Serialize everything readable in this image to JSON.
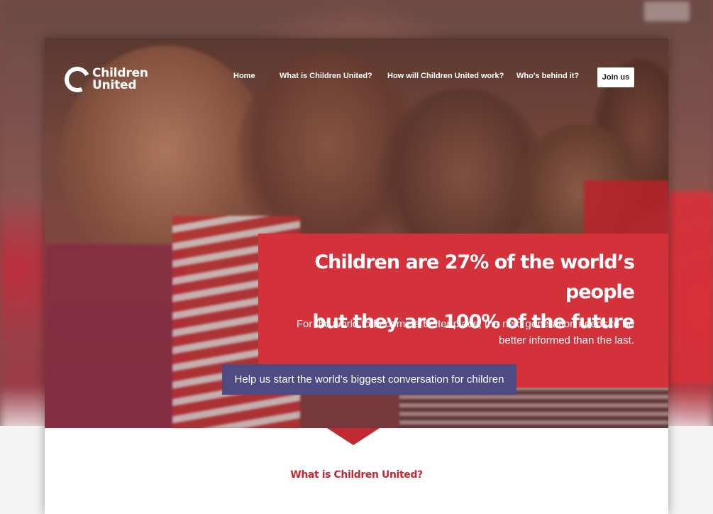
{
  "logo": {
    "line1": "Children",
    "line2": "United"
  },
  "nav": {
    "items": [
      {
        "label": "Home"
      },
      {
        "label": "What is Children United?"
      },
      {
        "label": "How will Children United work?"
      },
      {
        "label": "Who's behind it?"
      }
    ],
    "join_label": "Join us"
  },
  "hero": {
    "headline_line1": "Children are 27% of the world’s people",
    "headline_line2": "but they are 100% of the future",
    "subtext": "For the world to become a better place, the next generation needs to be better informed than the last.",
    "cta_label": "Help us start the world’s biggest conversation for children"
  },
  "section": {
    "title": "What is Children United?"
  },
  "colors": {
    "red": "#d4323a",
    "cta": "#4d4a84",
    "title_red": "#c8262f"
  }
}
